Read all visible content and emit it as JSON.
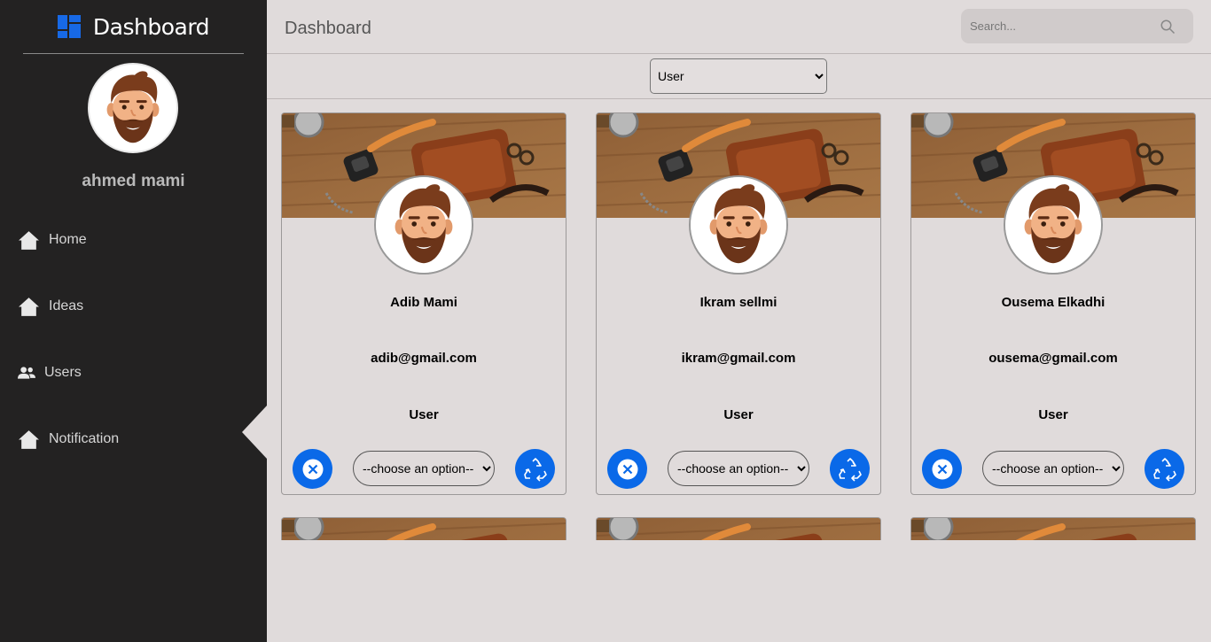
{
  "app": {
    "title": "Dashboard",
    "brand_color": "#1769e6",
    "sidebar_bg": "#232222",
    "page_bg": "#e0dbdb",
    "accent": "#0a69e8"
  },
  "sidebar": {
    "brand": "Dashboard",
    "profile_name": "ahmed mami",
    "items": [
      {
        "label": "Home",
        "icon": "home-icon"
      },
      {
        "label": "Ideas",
        "icon": "home-icon"
      },
      {
        "label": "Users",
        "icon": "users-icon"
      },
      {
        "label": "Notification",
        "icon": "home-icon"
      }
    ],
    "active_item": "Notification"
  },
  "header": {
    "title": "Dashboard",
    "search_placeholder": "Search..."
  },
  "filter": {
    "selected": "User",
    "options": [
      "User"
    ]
  },
  "cards": [
    {
      "name": "Adib Mami",
      "email": "adib@gmail.com",
      "role": "User",
      "select_placeholder": "--choose an option--"
    },
    {
      "name": "Ikram sellmi",
      "email": "ikram@gmail.com",
      "role": "User",
      "select_placeholder": "--choose an option--"
    },
    {
      "name": "Ousema Elkadhi",
      "email": "ousema@gmail.com",
      "role": "User",
      "select_placeholder": "--choose an option--"
    }
  ]
}
